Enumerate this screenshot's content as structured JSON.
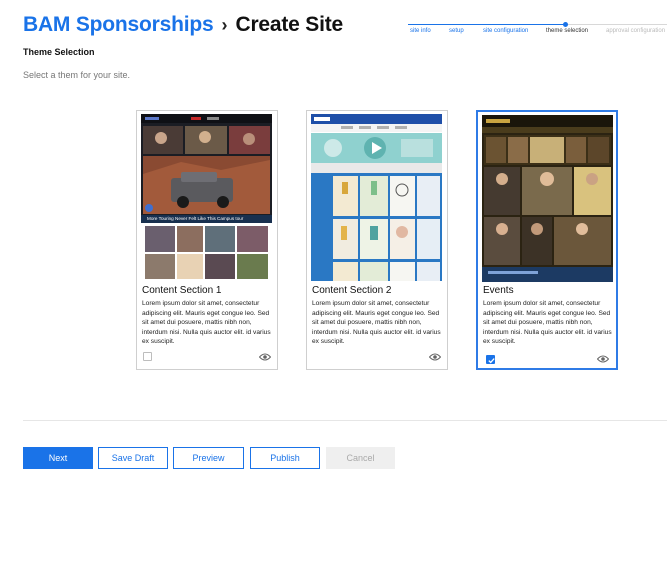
{
  "header": {
    "brand": "BAM Sponsorships",
    "separator": "›",
    "title": "Create Site"
  },
  "stepper": {
    "steps": [
      {
        "label": "site info",
        "state": "done"
      },
      {
        "label": "setup",
        "state": "done"
      },
      {
        "label": "site configuration",
        "state": "done"
      },
      {
        "label": "theme selection",
        "state": "current"
      },
      {
        "label": "approval configuration",
        "state": "future"
      }
    ]
  },
  "section": {
    "title": "Theme Selection",
    "subtitle": "Select a them for your site."
  },
  "themes": [
    {
      "title": "Content Section 1",
      "description": "Lorem ipsum dolor sit amet, consectetur adipiscing elit. Mauris eget congue leo. Sed sit amet dui posuere, mattis nibh non, interdum nisi. Nulla quis auctor elit. id varius ex suscipit.",
      "selected": false,
      "preview_caption": "More Touring Never Felt Like This Campus tour"
    },
    {
      "title": "Content Section 2",
      "description": "Lorem ipsum dolor sit amet, consectetur adipiscing elit. Mauris eget congue leo. Sed sit amet dui posuere, mattis nibh non, interdum nisi. Nulla quis auctor elit. id varius ex suscipit.",
      "selected": false
    },
    {
      "title": "Events",
      "description": "Lorem ipsum dolor sit amet, consectetur adipiscing elit. Mauris eget congue leo. Sed sit amet dui posuere, mattis nibh non, interdum nisi. Nulla quis auctor elit. id varius ex suscipit.",
      "selected": true
    }
  ],
  "actions": {
    "next": "Next",
    "save_draft": "Save Draft",
    "preview": "Preview",
    "publish": "Publish",
    "cancel": "Cancel"
  },
  "colors": {
    "accent": "#1a73e8",
    "disabled_bg": "#efefef",
    "disabled_text": "#aaaaaa"
  },
  "icons": {
    "preview": "eye-icon",
    "checkbox_checked": "checkmark-icon"
  }
}
